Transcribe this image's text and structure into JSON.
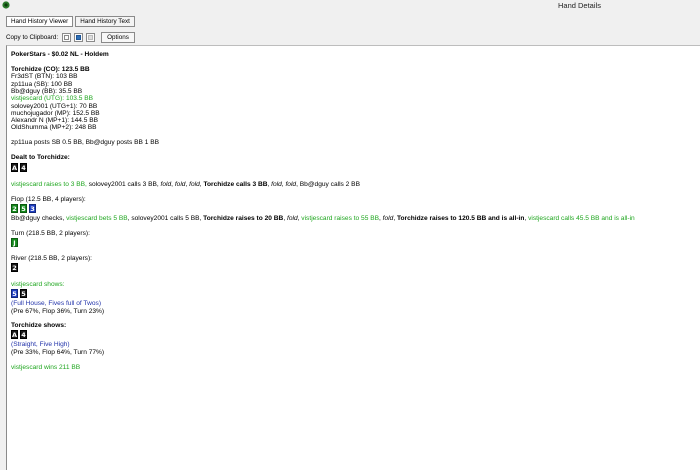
{
  "window": {
    "title": "Hand Details"
  },
  "tabs": [
    {
      "label": "Hand History Viewer"
    },
    {
      "label": "Hand History Text"
    }
  ],
  "toolbar": {
    "copy_label": "Copy to Clipboard:",
    "options_label": "Options"
  },
  "hand": {
    "header": "PokerStars - $0.02 NL - Holdem",
    "hero_line": "Torchidze (CO): 123.5 BB",
    "players": [
      "Fr3dST (BTN): 103 BB",
      "zp11ua (SB): 100 BB",
      "Bb@dguy (BB): 35.5 BB",
      "vistjescard (UTG): 103.5 BB",
      "solovey2001 (UTG+1): 70 BB",
      "muchojugador (MP): 152.5 BB",
      "Alexandr N (MP+1): 144.5 BB",
      "OldShumma (MP+2): 248 BB"
    ],
    "blinds": "zp11ua posts SB 0.5 BB, Bb@dguy posts BB 1 BB",
    "dealt_label": "Dealt to Torchidze:",
    "hero_cards": [
      "A",
      "4"
    ],
    "preflop": {
      "p1": "vistjescard raises to 3 BB,",
      "p2": " solovey2001 calls 3 BB, ",
      "p3": "fold",
      "p4": ", ",
      "p5": "fold",
      "p6": ", ",
      "p7": "fold",
      "p8": ", ",
      "p9": "Torchidze calls 3 BB",
      "p10": ", ",
      "p11": "fold",
      "p12": ", ",
      "p13": "fold",
      "p14": ", Bb@dguy calls 2 BB"
    },
    "flop_label": "Flop (12.5 BB, 4 players):",
    "flop_cards": [
      "2",
      "5",
      "3"
    ],
    "flop": {
      "p1": "Bb@dguy checks, ",
      "p2": "vistjescard bets 5 BB",
      "p3": ", solovey2001 calls 5 BB, ",
      "p4": "Torchidze raises to 20 BB",
      "p5": ", ",
      "p6": "fold",
      "p7": ", ",
      "p8": "vistjescard raises to 55 BB",
      "p9": ", ",
      "p10": "fold",
      "p11": ", ",
      "p12": "Torchidze raises to 120.5 BB and is all-in",
      "p13": ", ",
      "p14": "vistjescard calls 45.5 BB and is all-in"
    },
    "turn_label": "Turn (218.5 BB, 2 players):",
    "turn_card": "J",
    "river_label": "River (218.5 BB, 2 players):",
    "river_card": "2",
    "villain_shows_label": "vistjescard shows:",
    "villain_cards": [
      "5",
      "5"
    ],
    "villain_hand": "(Full House, Fives full of Twos)",
    "villain_equity": "(Pre 67%, Flop 36%, Turn 23%)",
    "hero_shows_label": "Torchidze shows:",
    "hero_show_cards": [
      "A",
      "4"
    ],
    "hero_hand": "(Straight, Five High)",
    "hero_equity": "(Pre 33%, Flop 64%, Turn 77%)",
    "winner": "vistjescard wins 211 BB"
  },
  "colors": {
    "green_text": "#1fa61f",
    "blue_text": "#2233aa",
    "card_black": "#1a1a1a",
    "card_green": "#148a1c",
    "card_blue": "#1f3ec2"
  }
}
